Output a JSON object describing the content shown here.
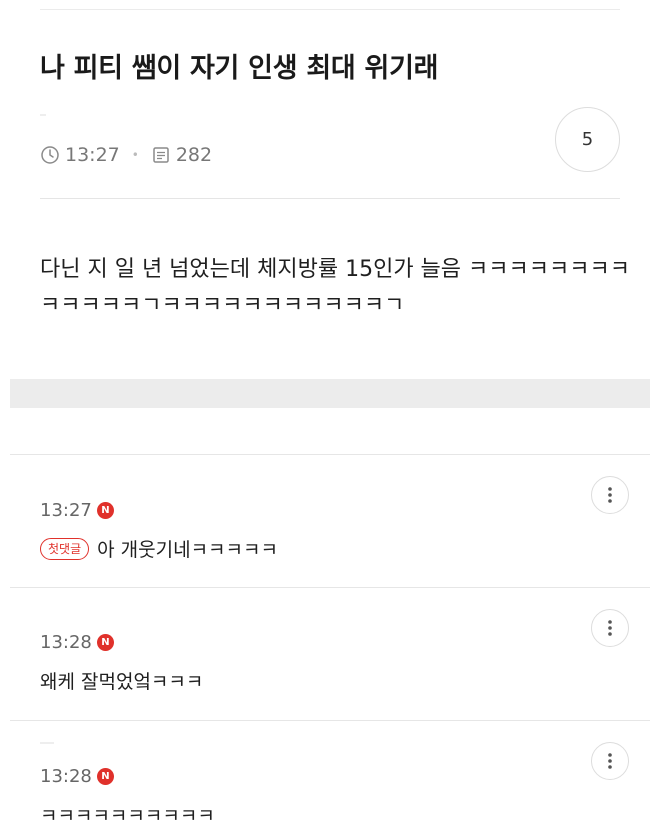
{
  "post": {
    "title": "나 피티 쌤이 자기 인생 최대 위기래",
    "time": "13:27",
    "views": "282",
    "comment_count": "5",
    "body": "다닌 지 일 년 넘었는데 체지방률 15인가 늘음 ㅋㅋㅋㅋㅋㅋㅋㅋㅋㅋㅋㅋㅋㄱㅋㅋㅋㅋㅋㅋㅋㅋㅋㅋㅋㄱ"
  },
  "comments": [
    {
      "time": "13:27",
      "badge": "N",
      "tag": "첫댓글",
      "text": "아 개웃기네ㅋㅋㅋㅋㅋ"
    },
    {
      "time": "13:28",
      "badge": "N",
      "text": "왜케 잘먹었엌ㅋㅋㅋ"
    },
    {
      "time": "13:28",
      "badge": "N",
      "text": "ㅋㅋㅋㅋㅋㅋㅋㅋㅋㅋ"
    }
  ],
  "icons": {
    "clock": "clock-icon",
    "views": "views-icon",
    "more": "more-vertical-icon"
  },
  "colors": {
    "new_badge": "#e0312b",
    "first_tag": "#e0312b"
  }
}
